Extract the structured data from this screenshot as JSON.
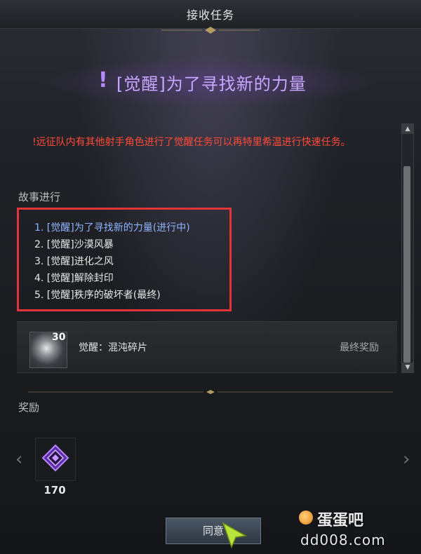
{
  "window": {
    "title": "接收任务"
  },
  "quest": {
    "marker": "!",
    "title": "[觉醒]为了寻找新的力量",
    "notice": "!远征队内有其他射手角色进行了觉醒任务可以再特里希温进行快速任务。"
  },
  "story": {
    "label": "故事进行",
    "items": [
      "1. [觉醒]为了寻找新的力量(进行中)",
      "2. [觉醒]沙漠风暴",
      "3. [觉醒]进化之风",
      "4. [觉醒]解除封印",
      "5. [觉醒]秩序的破坏者(最终)"
    ],
    "active_index": 0,
    "final_reward": {
      "count": "30",
      "name": "觉醒：混沌碎片",
      "tag": "最终奖励",
      "icon": "chaos-shard-icon"
    }
  },
  "rewards": {
    "label": "奖励",
    "items": [
      {
        "amount": "170",
        "icon": "purple-gem-icon"
      }
    ]
  },
  "actions": {
    "agree_label": "同意"
  },
  "watermark": {
    "brand": "蛋蛋吧",
    "url": "dd008.com"
  },
  "colors": {
    "notice": "#ff4a3a",
    "quest_title": "#c9a8ff",
    "active_story": "#8fb4ff",
    "highlight_box": "#e2343a"
  }
}
